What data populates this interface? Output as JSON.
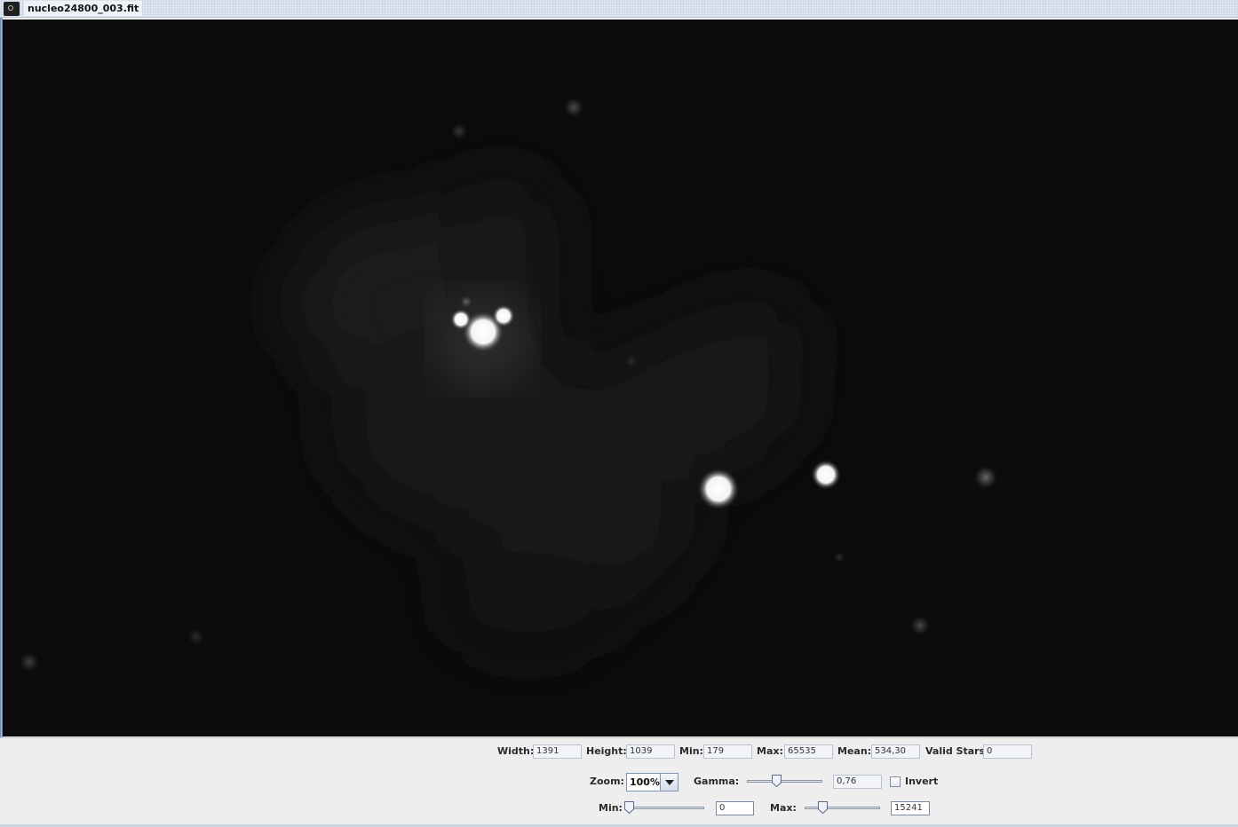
{
  "window": {
    "title": "nucleo24800_003.fit",
    "icon": "camera-icon"
  },
  "stats": {
    "width_label": "Width:",
    "width_value": "1391",
    "height_label": "Height:",
    "height_value": "1039",
    "min_label": "Min:",
    "min_value": "179",
    "max_label": "Max:",
    "max_value": "65535",
    "mean_label": "Mean:",
    "mean_value": "534,30",
    "valid_stars_label": "Valid Stars",
    "valid_stars_value": "0"
  },
  "display": {
    "zoom_label": "Zoom:",
    "zoom_value": "100%",
    "gamma_label": "Gamma:",
    "gamma_value": "0,76",
    "invert_label": "Invert",
    "invert_checked": false
  },
  "levels": {
    "min_label": "Min:",
    "min_value": "0",
    "max_label": "Max:",
    "max_value": "15241"
  }
}
